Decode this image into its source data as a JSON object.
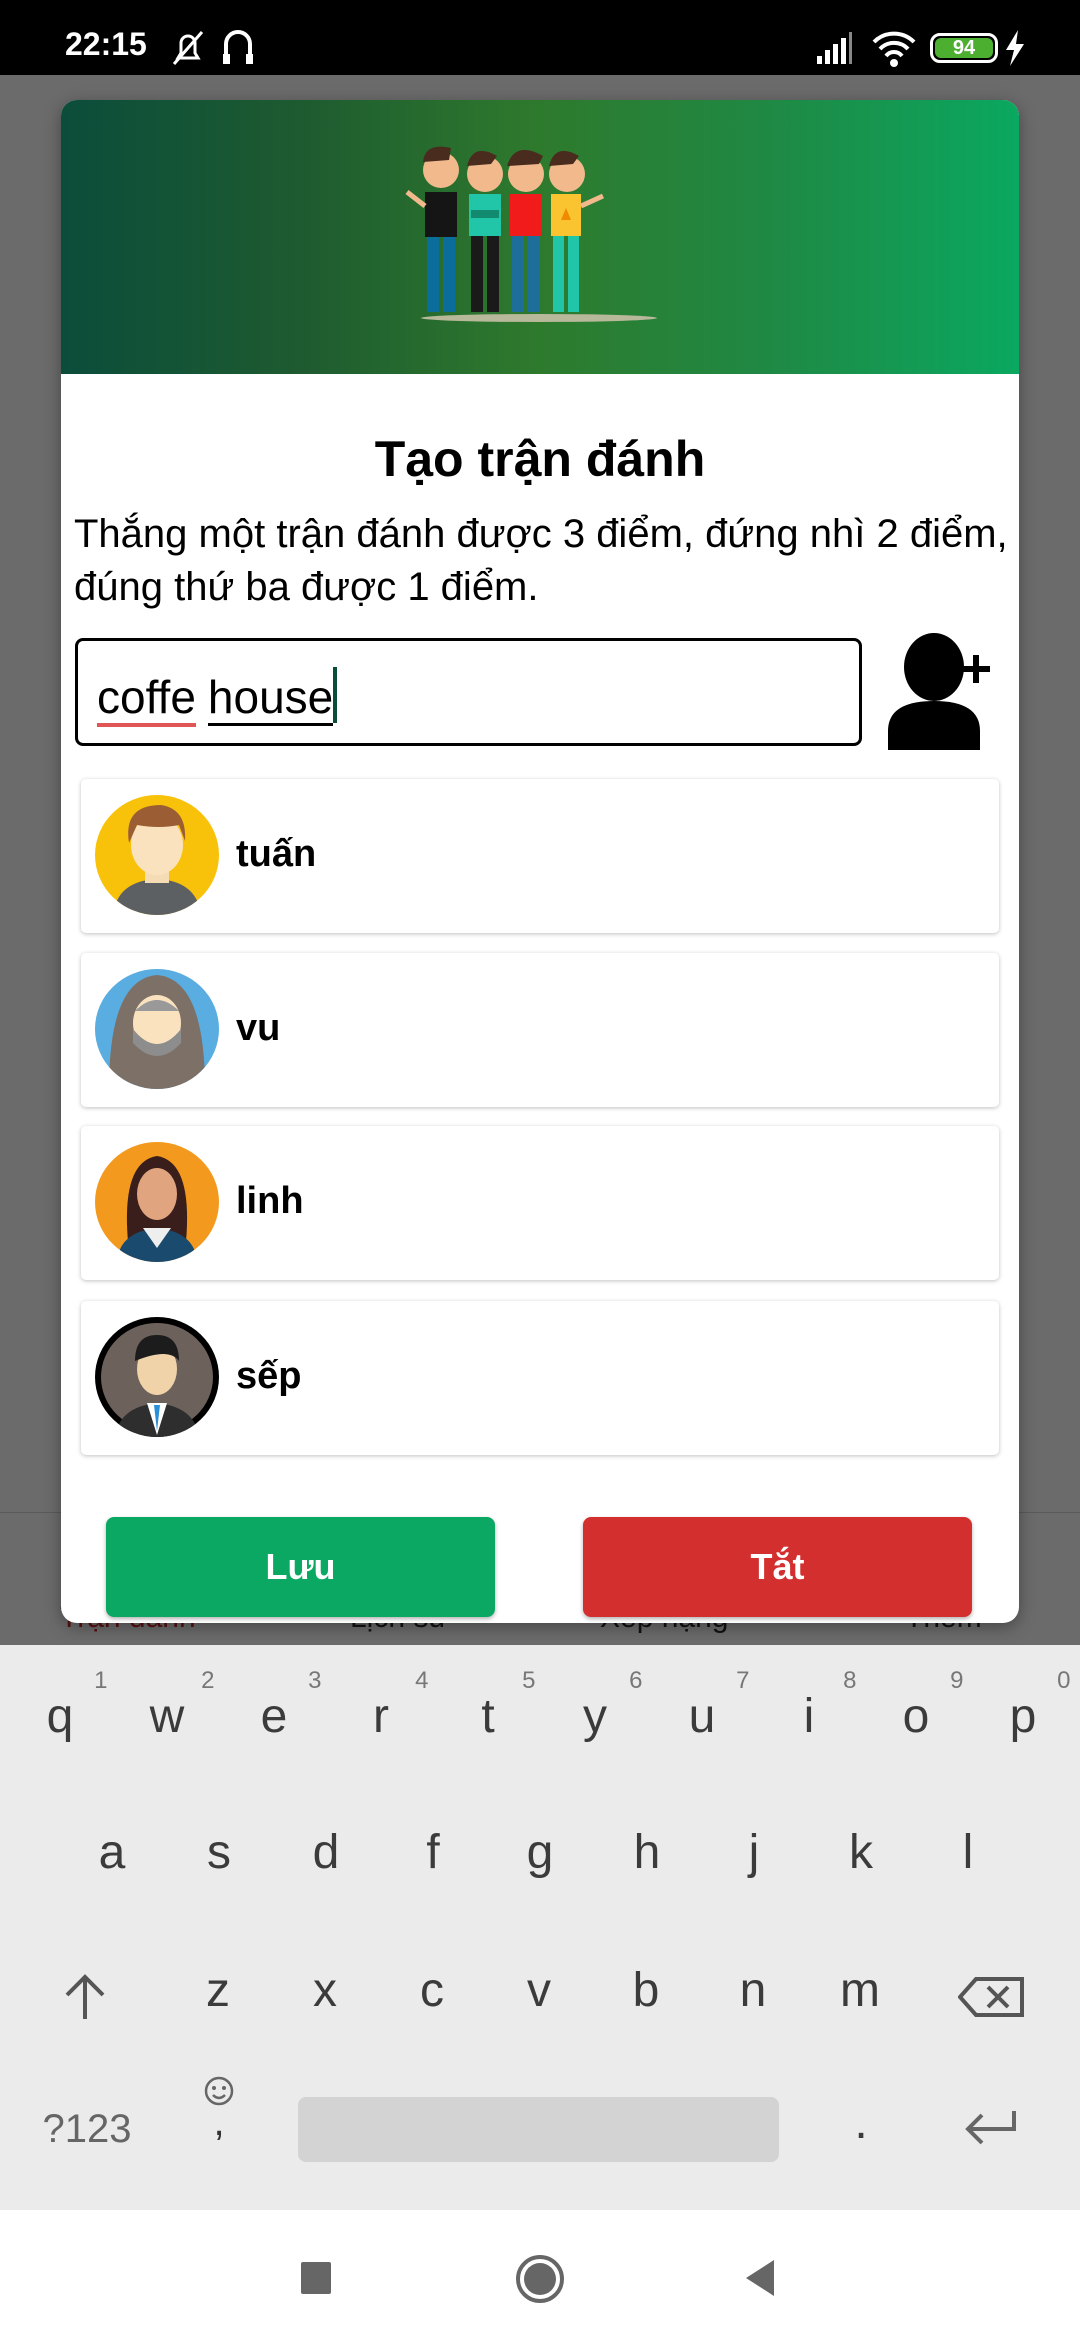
{
  "status_bar": {
    "time": "22:15",
    "battery": "94",
    "icons": [
      "bell-off-icon",
      "headset-icon",
      "signal-icon",
      "wifi-icon",
      "battery-icon",
      "charging-icon"
    ]
  },
  "background_nav": {
    "items": [
      "Trận đánh",
      "Lịch sử",
      "Xếp hạng",
      "Thêm"
    ],
    "active_color": "#8b1a1a"
  },
  "dialog": {
    "title": "Tạo trận đánh",
    "description": "Thắng một trận đánh được 3 điểm, đứng nhì 2 điểm, đúng thứ ba được 1 điểm.",
    "input": {
      "word1": "coffe",
      "word2": "house"
    },
    "add_player_icon": "add-user-icon",
    "players": [
      {
        "name": "tuấn",
        "avatar_color": "#f9c20a"
      },
      {
        "name": "vu",
        "avatar_color": "#5aade0"
      },
      {
        "name": "linh",
        "avatar_color": "#f39a1e"
      },
      {
        "name": "sếp",
        "avatar_color": "#6d625b"
      }
    ],
    "save_label": "Lưu",
    "close_label": "Tắt",
    "colors": {
      "save": "#0aa862",
      "close": "#d32f2f"
    }
  },
  "keyboard": {
    "row1": [
      {
        "k": "q",
        "n": "1"
      },
      {
        "k": "w",
        "n": "2"
      },
      {
        "k": "e",
        "n": "3"
      },
      {
        "k": "r",
        "n": "4"
      },
      {
        "k": "t",
        "n": "5"
      },
      {
        "k": "y",
        "n": "6"
      },
      {
        "k": "u",
        "n": "7"
      },
      {
        "k": "i",
        "n": "8"
      },
      {
        "k": "o",
        "n": "9"
      },
      {
        "k": "p",
        "n": "0"
      }
    ],
    "row2": [
      "a",
      "s",
      "d",
      "f",
      "g",
      "h",
      "j",
      "k",
      "l"
    ],
    "row3": [
      "z",
      "x",
      "c",
      "v",
      "b",
      "n",
      "m"
    ],
    "symbols_label": "?123",
    "comma": ",",
    "period": "."
  },
  "nav_bar": {
    "icons": [
      "recents-icon",
      "home-icon",
      "back-icon"
    ]
  }
}
